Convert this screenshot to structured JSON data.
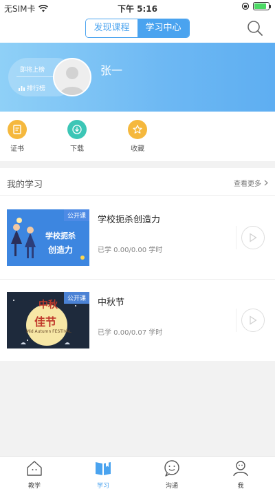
{
  "status_bar": {
    "carrier": "无SIM卡",
    "time": "下午 5:16",
    "battery_level": 0.85
  },
  "header": {
    "tabs": [
      {
        "label": "发现课程",
        "active": false
      },
      {
        "label": "学习中心",
        "active": true
      }
    ],
    "search_icon": "search-icon"
  },
  "profile": {
    "rank_up": "即将上榜",
    "rank_board": "排行榜",
    "name": "张一"
  },
  "shortcuts": [
    {
      "label": "证书",
      "icon": "certificate-icon",
      "color": "#f5b83d"
    },
    {
      "label": "下载",
      "icon": "download-icon",
      "color": "#3cc6b6"
    },
    {
      "label": "收藏",
      "icon": "star-icon",
      "color": "#f5b83d"
    }
  ],
  "my_learning": {
    "title": "我的学习",
    "more": "查看更多",
    "courses": [
      {
        "badge": "公开课",
        "title": "学校扼杀创造力",
        "progress": "已学 0.00/0.00 学时",
        "thumb_text_1": "学校扼杀",
        "thumb_text_2": "创造力"
      },
      {
        "badge": "公开课",
        "title": "中秋节",
        "progress": "已学 0.00/0.07 学时",
        "thumb_text_1": "中秋",
        "thumb_text_2": "佳节",
        "thumb_sub": "Mid Autumn FESTIVAL"
      }
    ]
  },
  "tabbar": {
    "items": [
      {
        "label": "教学",
        "icon": "home-icon",
        "active": false
      },
      {
        "label": "学习",
        "icon": "book-icon",
        "active": true
      },
      {
        "label": "沟通",
        "icon": "chat-icon",
        "active": false
      },
      {
        "label": "我",
        "icon": "user-icon",
        "active": false
      }
    ]
  },
  "colors": {
    "accent": "#4aa3ef",
    "banner_start": "#8fd0f7",
    "banner_end": "#5eaef2"
  }
}
